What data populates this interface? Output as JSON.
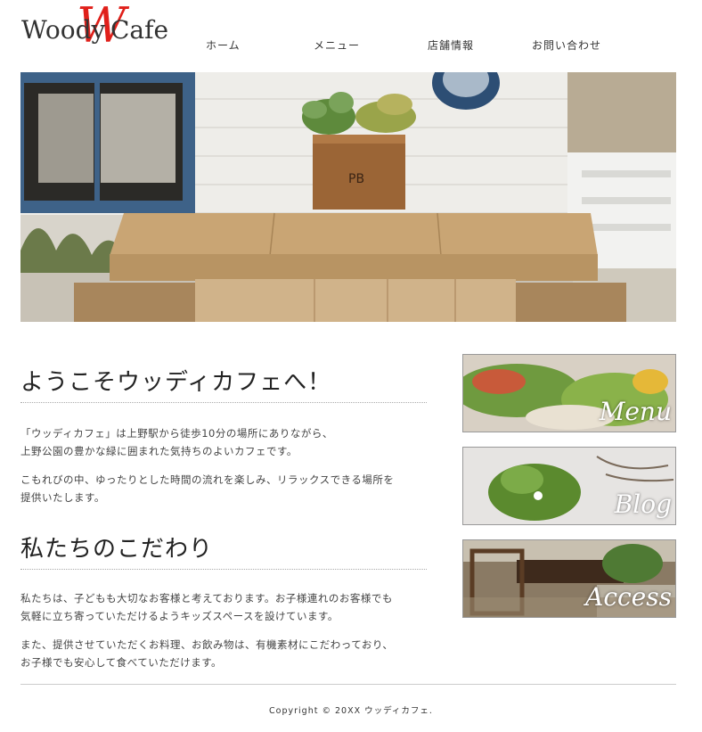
{
  "logo": {
    "left": "Woody",
    "mark": "W",
    "right": "Cafe"
  },
  "nav": [
    "ホーム",
    "メニュー",
    "店舗情報",
    "お問い合わせ"
  ],
  "welcome": {
    "title": "ようこそウッディカフェへ！",
    "p1_l1": "「ウッディカフェ」は上野駅から徒歩10分の場所にありながら、",
    "p1_l2": "上野公園の豊かな緑に囲まれた気持ちのよいカフェです。",
    "p2_l1": "こもれびの中、ゆったりとした時間の流れを楽しみ、リラックスできる場所を",
    "p2_l2": "提供いたします。"
  },
  "commitment": {
    "title": "私たちのこだわり",
    "p1_l1": "私たちは、子どもも大切なお客様と考えております。お子様連れのお客様でも",
    "p1_l2": "気軽に立ち寄っていただけるようキッズスペースを設けています。",
    "p2_l1": "また、提供させていただくお料理、お飲み物は、有機素材にこだわっており、",
    "p2_l2": "お子様でも安心して食べていただけます。"
  },
  "banners": [
    {
      "label": "Menu"
    },
    {
      "label": "Blog"
    },
    {
      "label": "Access"
    }
  ],
  "footer": {
    "copyright": "Copyright © 20XX ウッディカフェ."
  }
}
